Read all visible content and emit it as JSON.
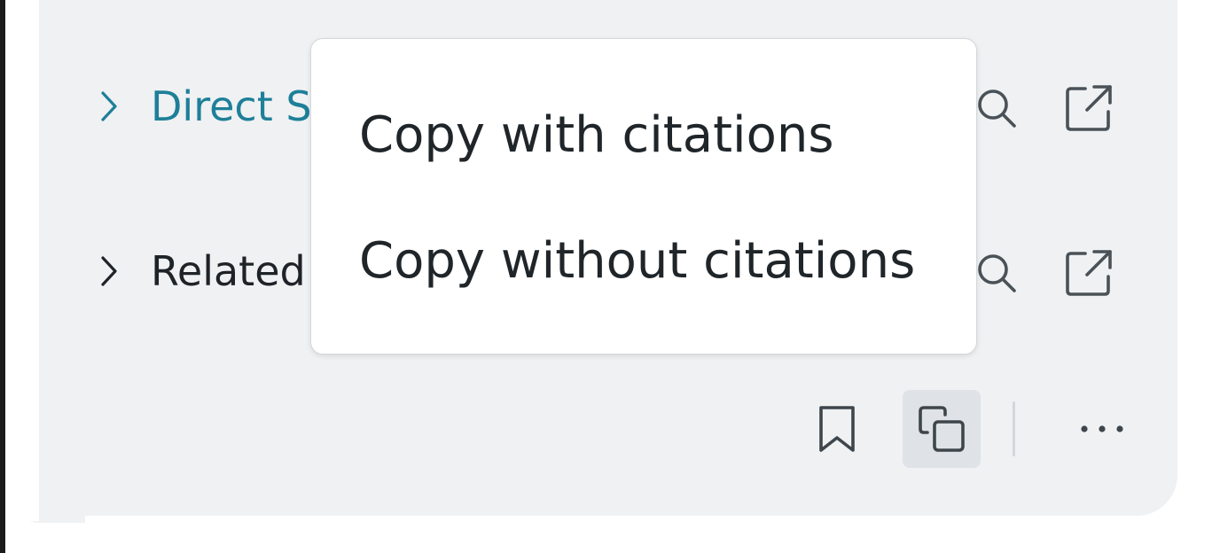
{
  "results": [
    {
      "label": "Direct S",
      "expanded": false
    },
    {
      "label": "Related",
      "expanded": false
    }
  ],
  "copy_menu": {
    "items": [
      {
        "label": "Copy with citations"
      },
      {
        "label": "Copy without citations"
      }
    ]
  },
  "icons": {
    "chevron": "chevron-right-icon",
    "preview": "preview-icon",
    "external": "external-link-icon",
    "bookmark": "bookmark-icon",
    "copy": "copy-icon",
    "more": "more-horizontal-icon"
  },
  "colors": {
    "link": "#1e7f98",
    "card_bg": "#eff1f3",
    "text": "#1f2529"
  }
}
